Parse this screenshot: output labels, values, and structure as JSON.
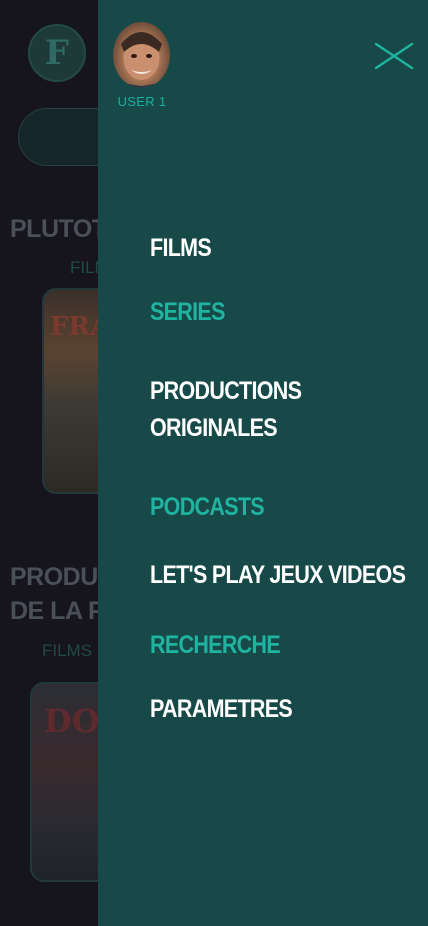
{
  "background": {
    "logo_letter": "F",
    "sections": [
      {
        "title": "PLUTOT F",
        "subtitle": "FILM"
      },
      {
        "title_lines": [
          "PRODUCT",
          "DE LA PL"
        ],
        "subtitle": "FILMS IN"
      }
    ],
    "posters": [
      {
        "title": "FRANK"
      },
      {
        "title": "DO"
      }
    ]
  },
  "drawer": {
    "user_label": "USER 1",
    "menu": [
      {
        "label": "FILMS",
        "color": "#ffffff"
      },
      {
        "label": "SERIES",
        "color": "#1fb3a0"
      },
      {
        "label_lines": [
          "PRODUCTIONS",
          "ORIGINALES"
        ],
        "color": "#ffffff"
      },
      {
        "label": "PODCASTS",
        "color": "#1fb3a0"
      },
      {
        "label": "LET'S PLAY JEUX VIDEOS",
        "color": "#ffffff"
      },
      {
        "label": "RECHERCHE",
        "color": "#1fb3a0"
      },
      {
        "label": "PARAMETRES",
        "color": "#ffffff"
      }
    ]
  },
  "colors": {
    "drawer_bg": "#174948",
    "accent": "#1fb3a0",
    "page_bg": "#16151d"
  },
  "icons": {
    "close": "close-icon",
    "avatar": "avatar"
  }
}
